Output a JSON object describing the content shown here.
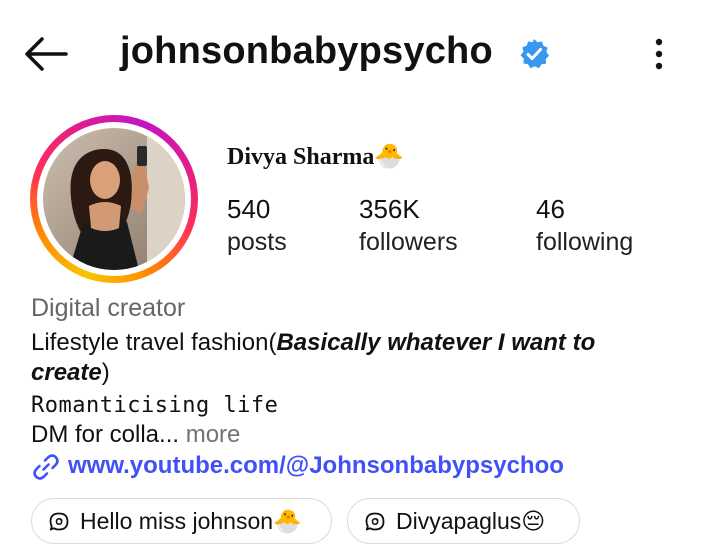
{
  "header": {
    "username": "johnsonbabypsycho",
    "verified_color": "#3897f0",
    "back_icon": "arrow-left-icon",
    "menu_icon": "more-vertical-icon"
  },
  "profile": {
    "full_name": "Divya Sharma🐣",
    "stats": [
      {
        "value": "540",
        "label": "posts"
      },
      {
        "value": "356K",
        "label": "followers"
      },
      {
        "value": "46",
        "label": "following"
      }
    ],
    "story_ring_colors": [
      "#f9c400",
      "#ff2f58",
      "#c313c7"
    ]
  },
  "bio": {
    "category": "Digital creator",
    "line1_prefix": "Lifestyle travel fashion(",
    "line1_bold": "Basically whatever I want to",
    "line2_bold": "create",
    "line2_suffix": ")",
    "line3": "𝚁𝚘𝚖𝚊𝚗𝚝𝚒𝚌𝚒𝚜𝚒𝚗𝚐 𝚕𝚒𝚏𝚎",
    "line4": "DM for colla...",
    "more_label": "more",
    "link_icon": "link-icon",
    "link_text": "www.youtube.com/@Johnsonbabypsychoo",
    "link_color": "#4150f7"
  },
  "threads_chips": [
    {
      "icon": "threads-bubble-icon",
      "label": "Hello miss johnson🐣"
    },
    {
      "icon": "threads-bubble-icon",
      "label": "Divyapaglus😔"
    }
  ]
}
